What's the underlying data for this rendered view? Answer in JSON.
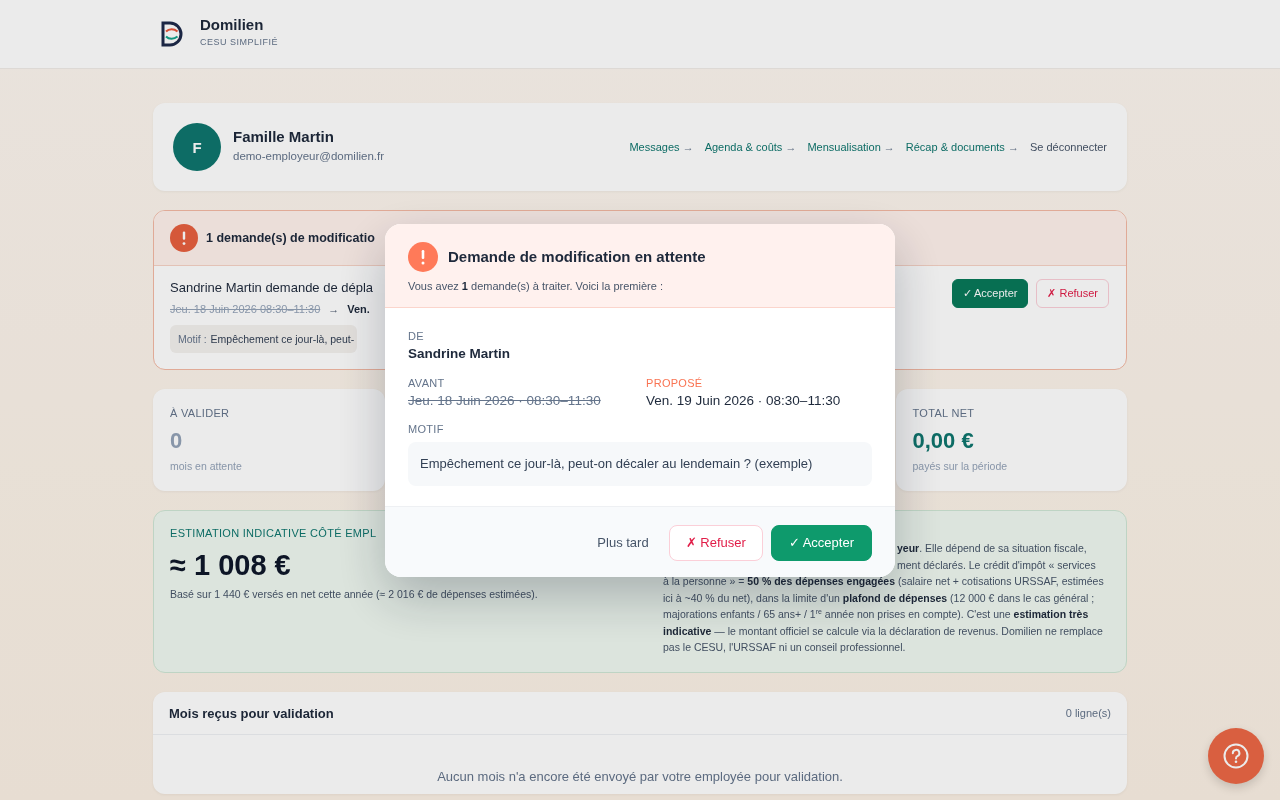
{
  "header": {
    "brand": "Domilien",
    "tagline": "CESU SIMPLIFIÉ"
  },
  "profile": {
    "initial": "F",
    "name": "Famille Martin",
    "email": "demo-employeur@domilien.fr",
    "nav": [
      {
        "label": "Messages",
        "arrow": "→"
      },
      {
        "label": "Agenda & coûts",
        "arrow": "→"
      },
      {
        "label": "Mensualisation",
        "arrow": "→"
      },
      {
        "label": "Récap & documents",
        "arrow": "→"
      }
    ],
    "logout": "Se déconnecter"
  },
  "alert": {
    "title": "1 demande(s) de modificatio",
    "summary": "Sandrine Martin demande de dépla",
    "before": "Jeu. 18 Juin 2026 08:30–11:30",
    "arrow": "→",
    "after": "Ven.",
    "reason_label": "Motif :",
    "reason": "Empêchement ce jour-là, peut-",
    "actions": [
      {
        "label": "✓ Accepter",
        "kind": "accept"
      },
      {
        "label": "✗ Refuser",
        "kind": "refuse"
      }
    ]
  },
  "stats": [
    {
      "label": "À VALIDER",
      "value": "0",
      "note": "mois en attente",
      "kind": "count"
    },
    {
      "label": "TOTAL NET",
      "value": "0,00 €",
      "note": "payés sur la période",
      "kind": "amount"
    }
  ],
  "estimate": {
    "label": "ESTIMATION INDICATIVE CÔTÉ EMPL",
    "amount": "≈ 1 008 €",
    "basis": "Basé sur 1 440 € versés en net cette année (≈ 2 016 € de dépenses estimées).",
    "fragments": [
      "**yeur**. Elle dépend de sa situation fiscale,",
      "ment déclarés. Le crédit d'impôt « services"
    ],
    "details": "à la personne » = **50 % des dépenses engagées** (salaire net + cotisations URSSAF, estimées ici à ~40 % du net), dans la limite d'un **plafond de dépenses** (12 000 € dans le cas général ; majorations enfants / 65 ans+ / 1$^{re}$ année non prises en compte). C'est une **estimation très indicative** — le montant officiel se calcule via la déclaration de revenus. Domilien ne remplace pas le CESU, l'URSSAF ni un conseil professionnel."
  },
  "months": {
    "title": "Mois reçus pour validation",
    "count": "0 ligne(s)",
    "empty": "Aucun mois n'a encore été envoyé par votre employée pour validation."
  },
  "modal": {
    "title": "Demande de modification en attente",
    "subtitle": "Vous avez **1** demande(s) à traiter. Voici la première :",
    "from_label": "DE",
    "from": "Sandrine Martin",
    "before_label": "AVANT",
    "before": "Jeu. 18 Juin 2026 · 08:30–11:30",
    "proposed_label": "PROPOSÉ",
    "proposed": "Ven. 19 Juin 2026 · 08:30–11:30",
    "reason_label": "MOTIF",
    "reason": "Empêchement ce jour-là, peut-on décaler au lendemain ? (exemple)",
    "actions": [
      {
        "label": "Plus tard",
        "kind": "later"
      },
      {
        "label": "✗ Refuser",
        "kind": "refuse"
      },
      {
        "label": "✓ Accepter",
        "kind": "accept"
      }
    ]
  }
}
